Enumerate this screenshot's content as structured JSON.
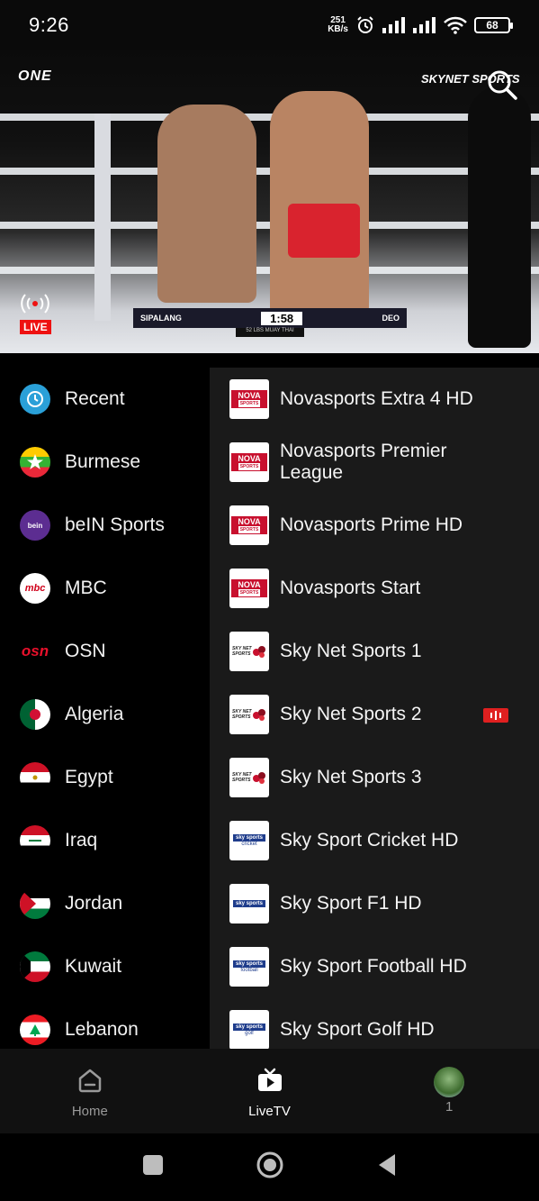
{
  "status_bar": {
    "time": "9:26",
    "net_speed_value": "251",
    "net_speed_unit": "KB/s",
    "battery": "68"
  },
  "player": {
    "brand_logo": "ONE",
    "channel_logo": "SKYNET SPORTS",
    "live_label": "LIVE",
    "scorebar": {
      "left_fighter": "SIPALANG",
      "clock": "1:58",
      "right_fighter": "DEO",
      "event": "52 LBS MUAY THAI"
    }
  },
  "categories": [
    {
      "label": "Recent",
      "icon": "clock-icon"
    },
    {
      "label": "Burmese",
      "icon": "myanmar-flag-icon"
    },
    {
      "label": "beIN Sports",
      "icon": "bein-icon"
    },
    {
      "label": "MBC",
      "icon": "mbc-icon"
    },
    {
      "label": "OSN",
      "icon": "osn-icon"
    },
    {
      "label": "Algeria",
      "icon": "algeria-flag-icon"
    },
    {
      "label": "Egypt",
      "icon": "egypt-flag-icon"
    },
    {
      "label": "Iraq",
      "icon": "iraq-flag-icon"
    },
    {
      "label": "Jordan",
      "icon": "jordan-flag-icon"
    },
    {
      "label": "Kuwait",
      "icon": "kuwait-flag-icon"
    },
    {
      "label": "Lebanon",
      "icon": "lebanon-flag-icon"
    }
  ],
  "channels": [
    {
      "name": "Novasports Extra 4 HD",
      "logo": "nova"
    },
    {
      "name": "Novasports Premier League",
      "logo": "nova"
    },
    {
      "name": "Novasports Prime HD",
      "logo": "nova"
    },
    {
      "name": "Novasports Start",
      "logo": "nova"
    },
    {
      "name": "Sky Net Sports 1",
      "logo": "skynet"
    },
    {
      "name": "Sky Net Sports 2",
      "logo": "skynet",
      "now_playing": true
    },
    {
      "name": "Sky Net Sports 3",
      "logo": "skynet"
    },
    {
      "name": "Sky Sport Cricket HD",
      "logo": "skysport"
    },
    {
      "name": "Sky Sport F1 HD",
      "logo": "skysport"
    },
    {
      "name": "Sky Sport Football HD",
      "logo": "skysport"
    },
    {
      "name": "Sky Sport Golf HD",
      "logo": "skysport"
    }
  ],
  "channel_logo_text": {
    "nova": "NOVA",
    "nova_sub": "SPORTS",
    "skynet": "SKY NET SPORTS",
    "skysport": "sky sports",
    "skysport_subs": [
      "",
      "",
      "",
      "",
      "",
      "",
      "",
      "cricket",
      "",
      "football",
      "golf"
    ]
  },
  "bottom_nav": {
    "home": "Home",
    "livetv": "LiveTV",
    "profile": "1"
  },
  "colors": {
    "accent": "#e02020",
    "sidebar_bg": "#000000",
    "list_bg": "#1a1a1a",
    "nav_bg": "#111111"
  }
}
